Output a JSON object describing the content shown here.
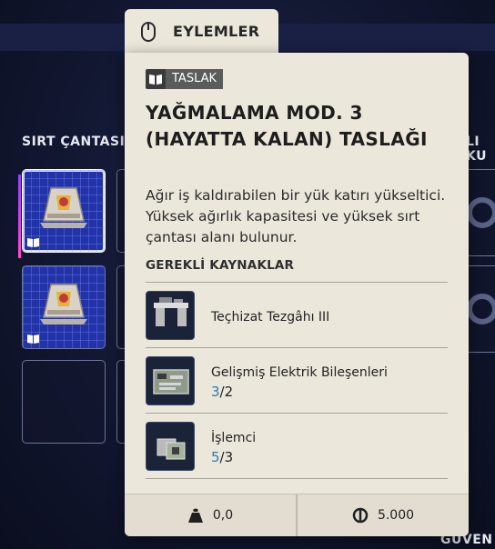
{
  "background": {
    "left_section_label": "SIRT ÇANTASI",
    "right_section_label": "LI KU",
    "bottom_right_label": "GÜVEN"
  },
  "tab": {
    "label": "EYLEMLER",
    "icon": "mouse-icon"
  },
  "tooltip": {
    "badge": "TASLAK",
    "badge_icon": "book-icon",
    "title": "YAĞMALAMA MOD. 3 (HAYATTA KALAN) TASLAĞI",
    "description": "Ağır iş kaldırabilen bir yük katırı yükseltici. Yüksek ağırlık kapasitesi ve yüksek sırt çantası alanı bulunur.",
    "requirements_header": "GEREKLİ KAYNAKLAR",
    "resources": [
      {
        "name": "Teçhizat Tezgâhı III",
        "have": "",
        "need": "",
        "icon": "workbench-icon"
      },
      {
        "name": "Gelişmiş Elektrik Bileşenleri",
        "have": "3",
        "need": "2",
        "icon": "circuit-board-icon"
      },
      {
        "name": "İşlemci",
        "have": "5",
        "need": "3",
        "icon": "processor-icon"
      }
    ],
    "footer": {
      "weight": "0,0",
      "weight_icon": "weight-icon",
      "value": "5.000",
      "value_icon": "currency-icon"
    }
  },
  "colors": {
    "panel_bg": "#ece7db",
    "count_accent": "#2c7cb0",
    "slot_accent": "#2233a8"
  }
}
